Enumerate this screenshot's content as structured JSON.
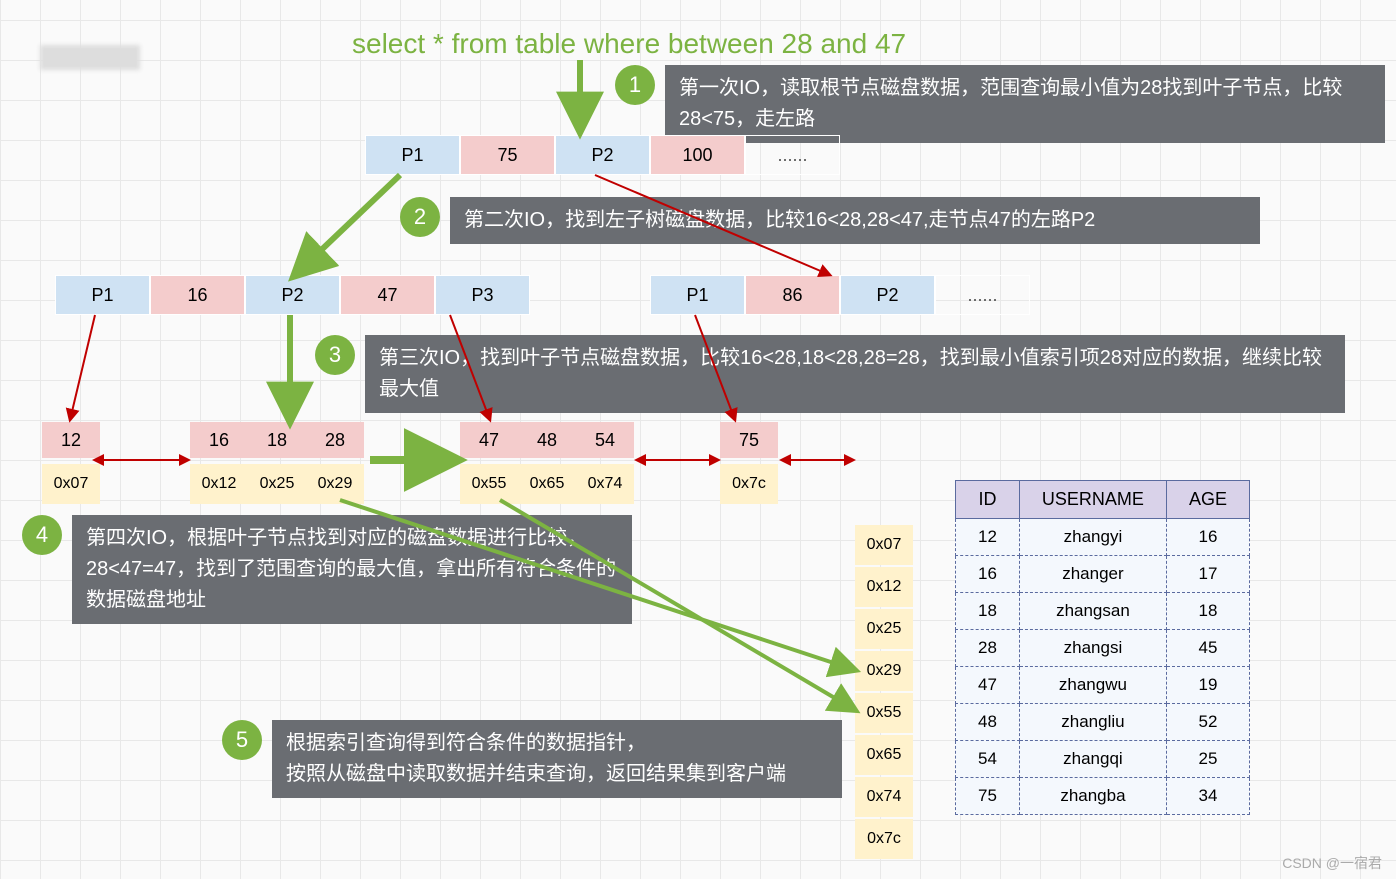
{
  "title": "select * from table where between 28 and 47",
  "steps": {
    "s1": {
      "num": "1",
      "text": "第一次IO，读取根节点磁盘数据，范围查询最小值为28找到叶子节点，比较28<75，走左路"
    },
    "s2": {
      "num": "2",
      "text": "第二次IO，找到左子树磁盘数据，比较16<28,28<47,走节点47的左路P2"
    },
    "s3": {
      "num": "3",
      "text": "第三次IO，找到叶子节点磁盘数据，比较16<28,18<28,28=28，找到最小值索引项28对应的数据，继续比较最大值"
    },
    "s4": {
      "num": "4",
      "text": "第四次IO，根据叶子节点找到对应的磁盘数据进行比较，28<47=47，找到了范围查询的最大值，拿出所有符合条件的数据磁盘地址"
    },
    "s5": {
      "num": "5",
      "text": "根据索引查询得到符合条件的数据指针，\n按照从磁盘中读取数据并结束查询，返回结果集到客户端"
    }
  },
  "root": {
    "p1": "P1",
    "k1": "75",
    "p2": "P2",
    "k2": "100",
    "dots": "......"
  },
  "left_child": {
    "p1": "P1",
    "k1": "16",
    "p2": "P2",
    "k2": "47",
    "p3": "P3"
  },
  "right_child": {
    "p1": "P1",
    "k1": "86",
    "p2": "P2",
    "dots": "......"
  },
  "leaves": {
    "l1": {
      "keys": [
        "12"
      ],
      "addrs": [
        "0x07"
      ]
    },
    "l2": {
      "keys": [
        "16",
        "18",
        "28"
      ],
      "addrs": [
        "0x12",
        "0x25",
        "0x29"
      ]
    },
    "l3": {
      "keys": [
        "47",
        "48",
        "54"
      ],
      "addrs": [
        "0x55",
        "0x65",
        "0x74"
      ]
    },
    "l4": {
      "keys": [
        "75"
      ],
      "addrs": [
        "0x7c"
      ]
    }
  },
  "addr_list": [
    "0x07",
    "0x12",
    "0x25",
    "0x29",
    "0x55",
    "0x65",
    "0x74",
    "0x7c"
  ],
  "table": {
    "headers": [
      "ID",
      "USERNAME",
      "AGE"
    ],
    "rows": [
      [
        "12",
        "zhangyi",
        "16"
      ],
      [
        "16",
        "zhanger",
        "17"
      ],
      [
        "18",
        "zhangsan",
        "18"
      ],
      [
        "28",
        "zhangsi",
        "45"
      ],
      [
        "47",
        "zhangwu",
        "19"
      ],
      [
        "48",
        "zhangliu",
        "52"
      ],
      [
        "54",
        "zhangqi",
        "25"
      ],
      [
        "75",
        "zhangba",
        "34"
      ]
    ]
  },
  "watermark": "CSDN @一宿君"
}
